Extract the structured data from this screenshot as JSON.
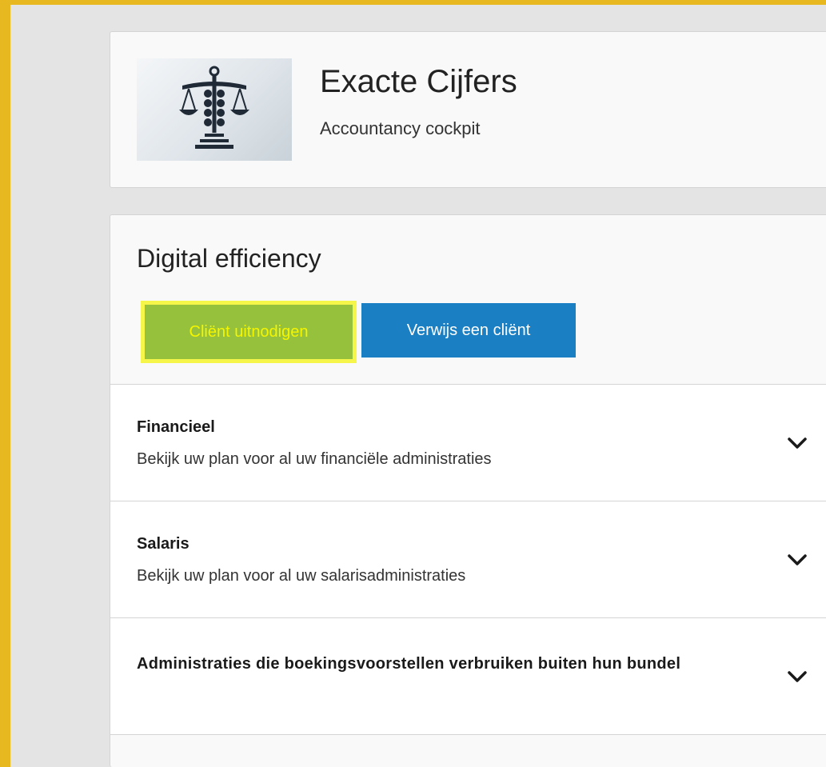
{
  "header": {
    "title": "Exacte Cijfers",
    "subtitle": "Accountancy cockpit",
    "logo_icon": "scales-of-justice-icon"
  },
  "section": {
    "title": "Digital efficiency",
    "buttons": {
      "invite_label": "Cliënt uitnodigen",
      "refer_label": "Verwijs een cliënt"
    },
    "panels": [
      {
        "title": "Financieel",
        "description": "Bekijk uw plan voor al uw financiële administraties",
        "icon": "chevron-down-icon"
      },
      {
        "title": "Salaris",
        "description": "Bekijk uw plan voor al uw salarisadministraties",
        "icon": "chevron-down-icon"
      },
      {
        "title": "Administraties die boekingsvoorstellen verbruiken buiten hun bundel",
        "icon": "chevron-down-icon"
      }
    ]
  },
  "colors": {
    "outer_border": "#e8b820",
    "invite_button": "#96c13c",
    "invite_text": "#f5f500",
    "highlight_outline": "#f6f54a",
    "refer_button": "#1b7fc4"
  }
}
